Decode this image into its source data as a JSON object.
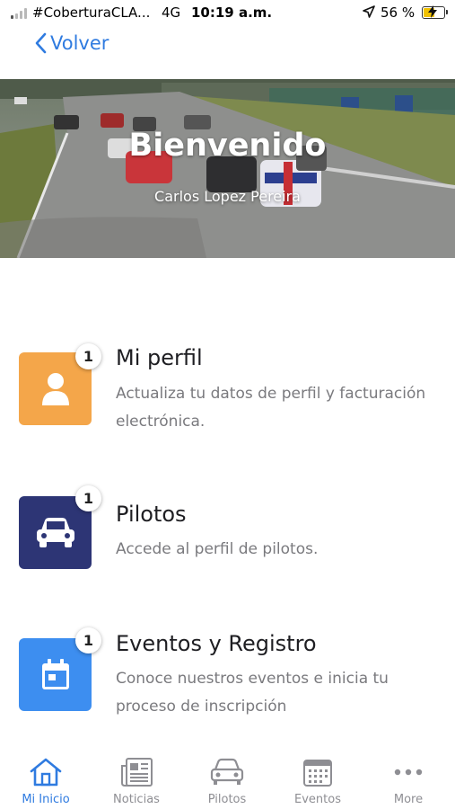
{
  "status_bar": {
    "carrier": "#CoberturaCLA...",
    "network": "4G",
    "time": "10:19 a.m.",
    "battery": "56 %",
    "battery_level": 0.56
  },
  "nav": {
    "back_label": "Volver"
  },
  "hero": {
    "title": "Bienvenido",
    "subtitle": "Carlos Lopez Pereira"
  },
  "menu": [
    {
      "title": "Mi perfil",
      "description": "Actualiza tu datos de perfil y facturación electrónica.",
      "badge": "1",
      "icon": "user-icon",
      "color": "#f4a64a"
    },
    {
      "title": "Pilotos",
      "description": "Accede al perfil de pilotos.",
      "badge": "1",
      "icon": "car-icon",
      "color": "#2d3575"
    },
    {
      "title": "Eventos y Registro",
      "description": "Conoce nuestros eventos e inicia tu proceso de inscripción",
      "badge": "1",
      "icon": "calendar-icon",
      "color": "#3d8ef0"
    }
  ],
  "tabs": [
    {
      "label": "Mi Inicio",
      "icon": "home-icon",
      "active": true
    },
    {
      "label": "Noticias",
      "icon": "newspaper-icon",
      "active": false
    },
    {
      "label": "Pilotos",
      "icon": "car-icon",
      "active": false
    },
    {
      "label": "Eventos",
      "icon": "calendar-icon",
      "active": false
    },
    {
      "label": "More",
      "icon": "more-icon",
      "active": false
    }
  ],
  "colors": {
    "accent": "#2f7be0",
    "inactive": "#8e8e93"
  }
}
